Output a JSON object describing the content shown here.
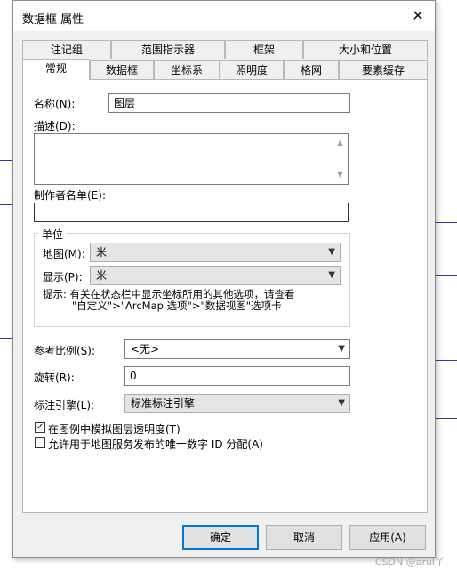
{
  "window": {
    "title": "数据框 属性",
    "close_icon": "✕"
  },
  "tabs_row1": [
    "注记组",
    "范围指示器",
    "框架",
    "大小和位置"
  ],
  "tabs_row2": [
    "常规",
    "数据框",
    "坐标系",
    "照明度",
    "格网",
    "要素缓存"
  ],
  "general": {
    "name_label": "名称(N):",
    "name_value": "图层",
    "desc_label": "描述(D):",
    "desc_value": "",
    "author_label": "制作者名单(E):",
    "author_value": "",
    "units_group": "单位",
    "map_label": "地图(M):",
    "map_value": "米",
    "display_label": "显示(P):",
    "display_value": "米",
    "hint_line1": "提示: 有关在状态栏中显示坐标所用的其他选项，请查看",
    "hint_line2": "\"自定义\">\"ArcMap 选项\">\"数据视图\"选项卡",
    "ref_scale_label": "参考比例(S):",
    "ref_scale_value": "<无>",
    "rotation_label": "旋转(R):",
    "rotation_value": "0",
    "label_engine_label": "标注引擎(L):",
    "label_engine_value": "标准标注引擎",
    "chk1_label": "在图例中模拟图层透明度(T)",
    "chk1_checked": true,
    "chk2_label": "允许用于地图服务发布的唯一数字 ID 分配(A)",
    "chk2_checked": false
  },
  "buttons": {
    "ok": "确定",
    "cancel": "取消",
    "apply": "应用(A)"
  },
  "watermark": "CSDN @arul丫"
}
